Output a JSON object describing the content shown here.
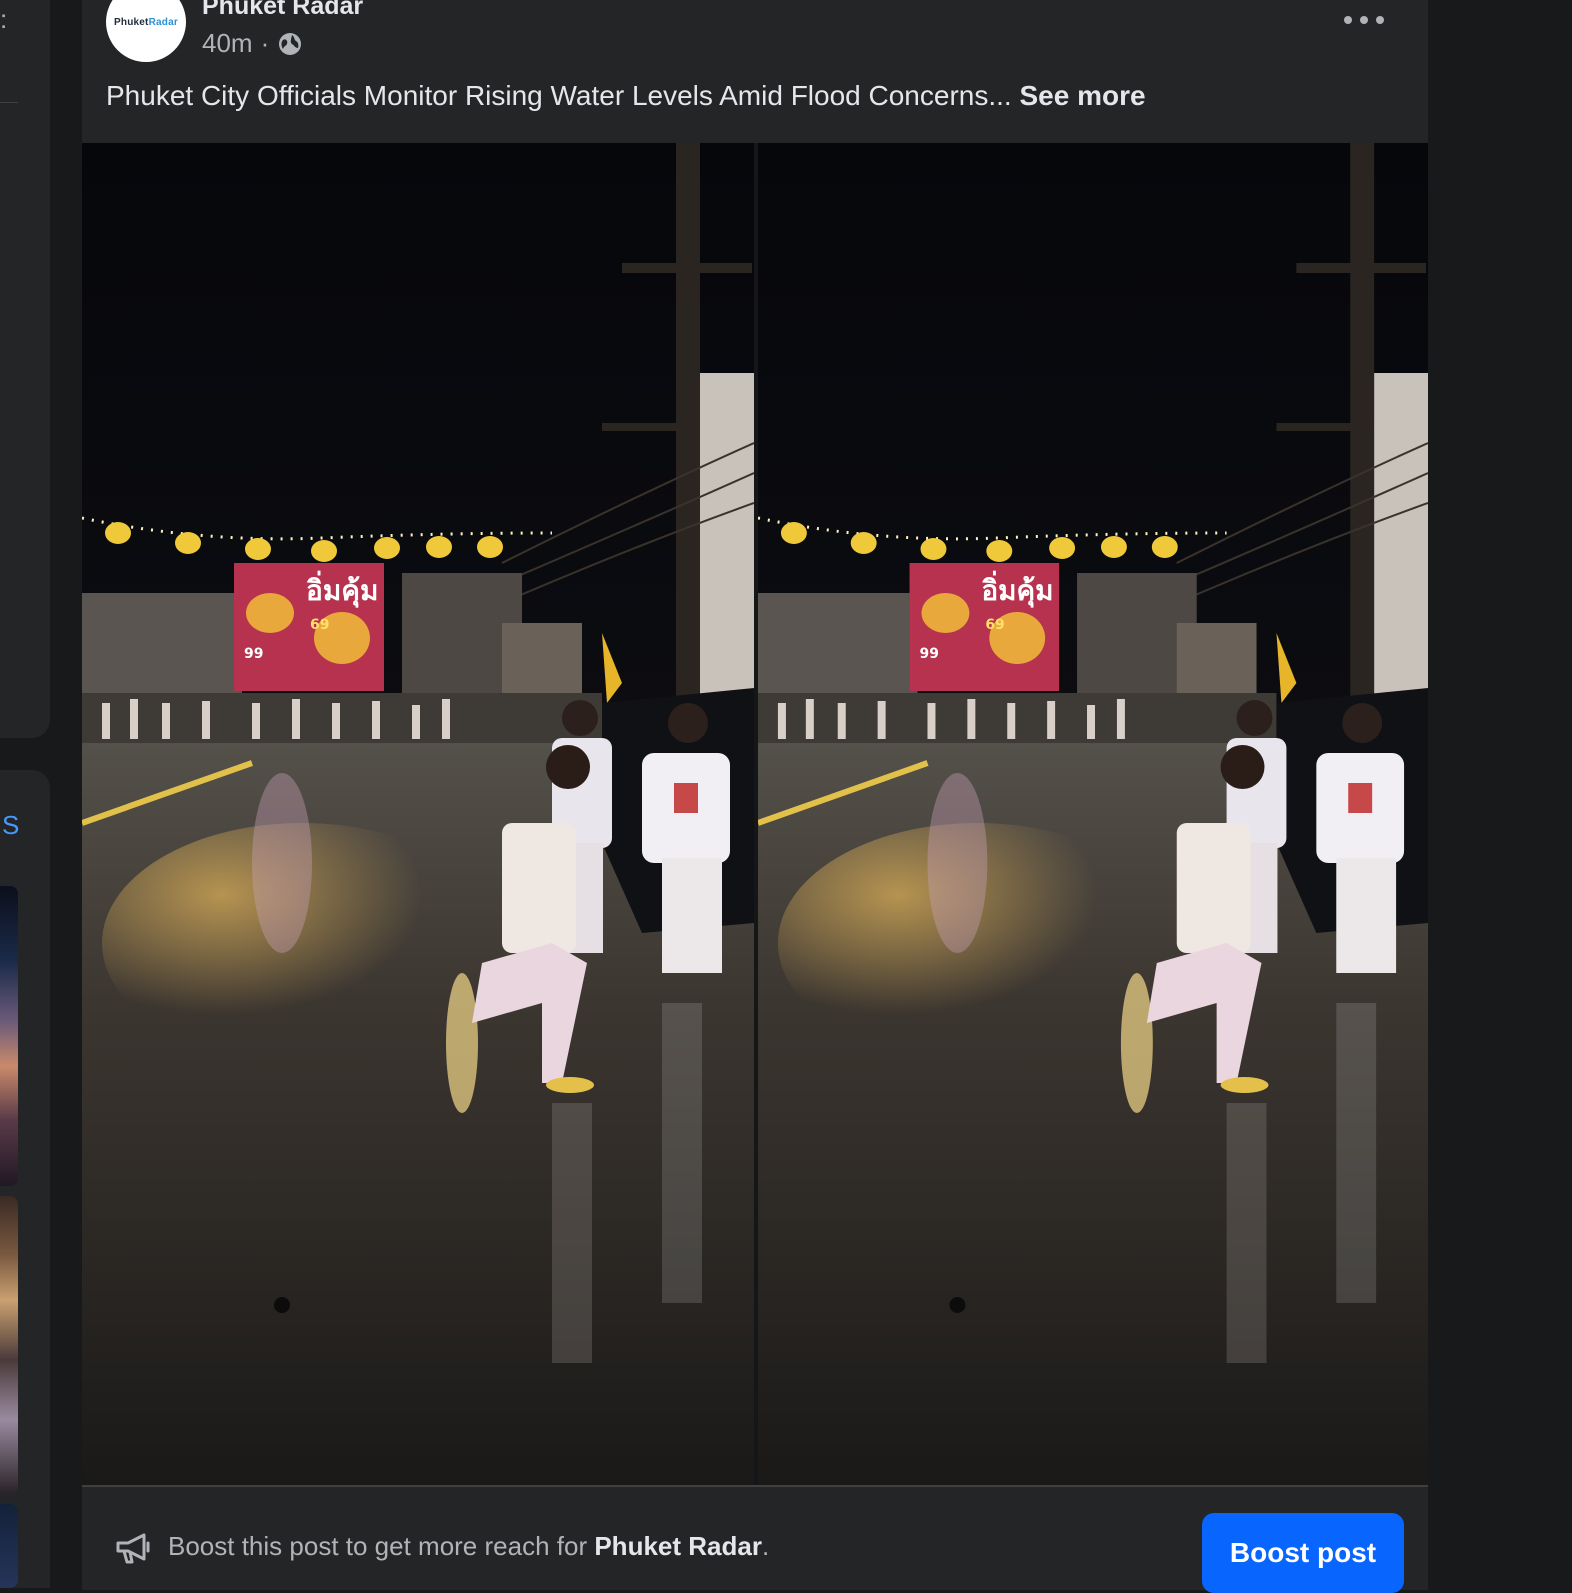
{
  "sidebar": {
    "top_fragment_char": ":",
    "section_link_fragment": "S"
  },
  "post": {
    "avatar_logo": {
      "prefix": "Phuket",
      "suffix": "Radar"
    },
    "page_name": "Phuket Radar",
    "timestamp": "40m",
    "separator": "·",
    "audience_icon": "globe-icon",
    "more_icon": "more-options-icon",
    "caption": "Phuket City Officials Monitor Rising Water Levels Amid Flood Concerns...",
    "see_more_label": "See more",
    "billboard_text": "อิ่มคุ้ม",
    "billboard_prices": [
      "69",
      "99"
    ]
  },
  "boost": {
    "icon": "megaphone-icon",
    "text_prefix": "Boost this post to get more reach for",
    "page_name": "Phuket Radar",
    "text_suffix": ".",
    "button_label": "Boost post",
    "button_color": "#0866ff"
  }
}
